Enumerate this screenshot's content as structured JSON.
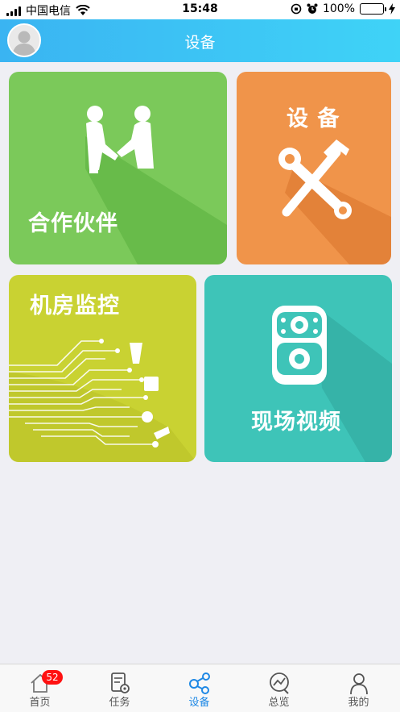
{
  "status_bar": {
    "carrier": "中国电信",
    "time": "15:48",
    "battery": "100%",
    "battery_level": 1.0,
    "icons": [
      "signal-icon",
      "wifi-icon",
      "orientation-lock-icon",
      "alarm-icon",
      "battery-icon",
      "charging-icon"
    ]
  },
  "header": {
    "title": "设备",
    "avatar_icon": "user-avatar-icon"
  },
  "tiles": {
    "partners": {
      "label": "合作伙伴",
      "icon": "handshake-icon",
      "color": "#7bc95a"
    },
    "device": {
      "label": "设 备",
      "icon": "wrench-hammer-icon",
      "color": "#f0944a"
    },
    "room_monitor": {
      "label": "机房监控",
      "icon": "circuit-icon",
      "color": "#c9d232"
    },
    "field_video": {
      "label": "现场视频",
      "icon": "body-camera-icon",
      "color": "#3ec4b8"
    }
  },
  "tabbar": {
    "items": [
      {
        "label": "首页",
        "icon": "home-icon",
        "badge": "52"
      },
      {
        "label": "任务",
        "icon": "task-icon"
      },
      {
        "label": "设备",
        "icon": "device-share-icon",
        "active": true
      },
      {
        "label": "总览",
        "icon": "overview-chart-icon"
      },
      {
        "label": "我的",
        "icon": "profile-icon"
      }
    ],
    "active_color": "#1e88e5"
  }
}
